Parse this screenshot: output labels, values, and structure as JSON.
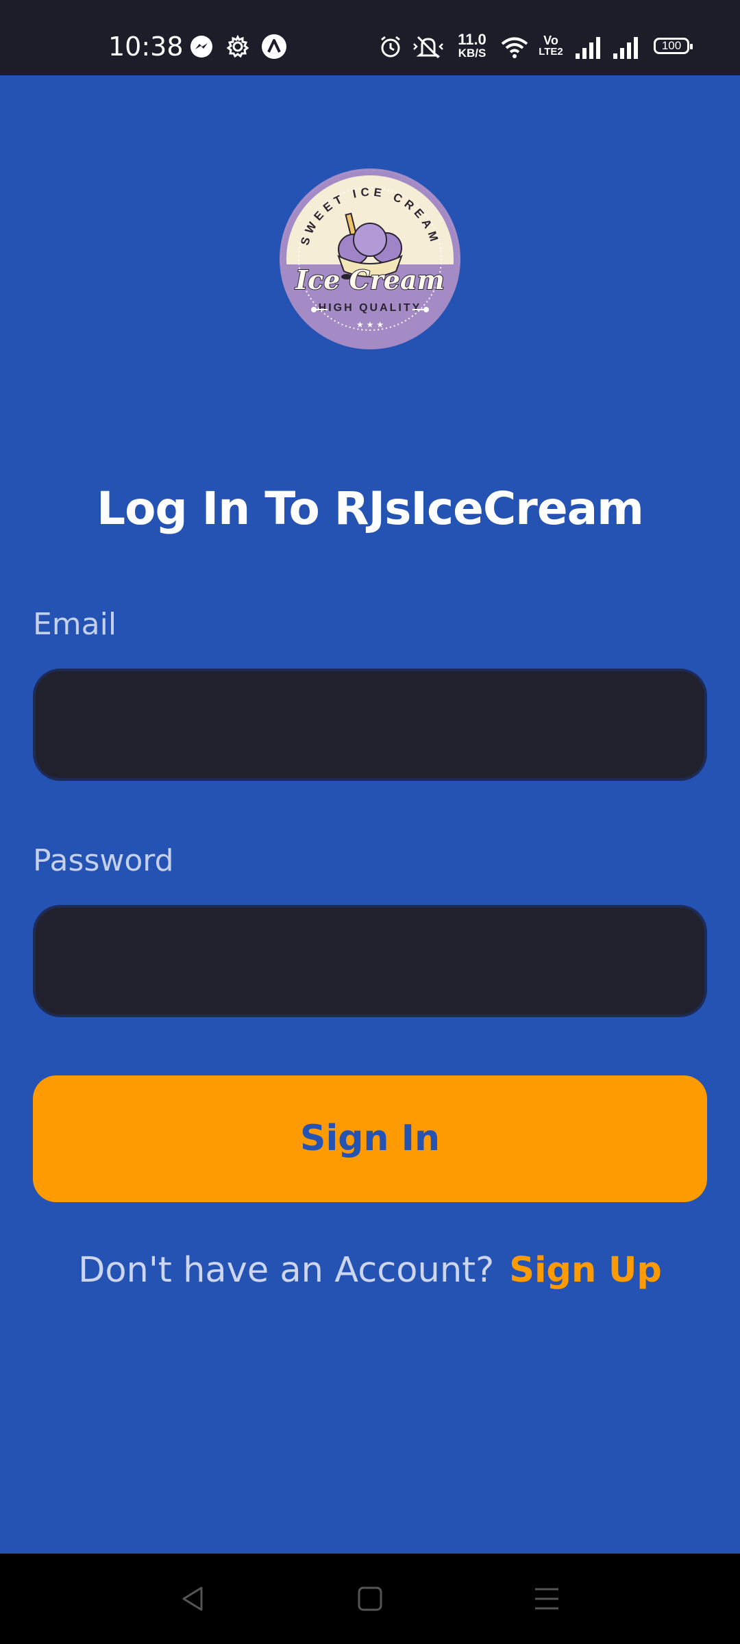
{
  "status_bar": {
    "time": "10:38",
    "network_speed_value": "11.0",
    "network_speed_unit": "KB/S",
    "volte_top": "Vo",
    "volte_bottom": "LTE2",
    "battery": "100",
    "icons": [
      "messenger-icon",
      "settings-gear-icon",
      "app-notification-icon",
      "alarm-icon",
      "silent-bell-icon",
      "wifi-icon",
      "signal-1-icon",
      "signal-2-icon",
      "battery-icon"
    ]
  },
  "logo": {
    "arc_text": "SWEET ICE CREAM",
    "main_text": "Ice Cream",
    "sub_text": "HIGH QUALITY",
    "stars": "★ ★ ★",
    "colors": {
      "purple": "#a48bc6",
      "cream": "#f6edd6",
      "dark": "#2a2430"
    }
  },
  "login": {
    "title": "Log In To RJsIceCream",
    "email_label": "Email",
    "email_value": "",
    "password_label": "Password",
    "password_value": "",
    "signin_label": "Sign In",
    "signup_prompt": "Don't have an Account?",
    "signup_link": "Sign Up"
  },
  "nav_bar": {
    "buttons": [
      "back-icon",
      "home-icon",
      "menu-icon"
    ]
  },
  "colors": {
    "background": "#2453b4",
    "status_bar": "#1c1d29",
    "input_background": "#21212d",
    "accent_orange": "#fe9a02",
    "label": "#c5d0ec",
    "nav_bar": "#000000"
  }
}
